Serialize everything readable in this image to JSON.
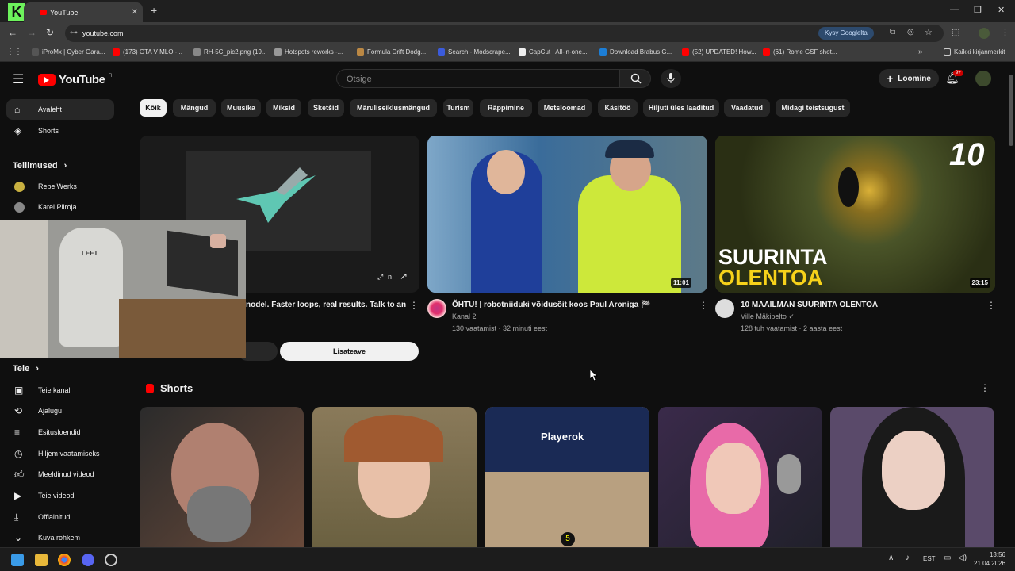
{
  "browser": {
    "tab_title": "YouTube",
    "url": "youtube.com",
    "gemini_label": "Kysy Googlelta",
    "bookmarks": [
      {
        "label": "iProMx | Cyber Gara...",
        "color": "#555"
      },
      {
        "label": "(173) GTA V MLO -...",
        "color": "#ff0000"
      },
      {
        "label": "RH-5C_pic2.png (19...",
        "color": "#888"
      },
      {
        "label": "Hotspots reworks -...",
        "color": "#999"
      },
      {
        "label": "Formula Drift Dodg...",
        "color": "#bb8844"
      },
      {
        "label": "Search - Modscrape...",
        "color": "#3b5bdb"
      },
      {
        "label": "CapCut | All-in-one...",
        "color": "#eee"
      },
      {
        "label": "Download Brabus G...",
        "color": "#1c7ed6"
      },
      {
        "label": "(52) UPDATED! How...",
        "color": "#ff0000"
      },
      {
        "label": "(61) Rome GSF shot...",
        "color": "#ff0000"
      }
    ],
    "all_bookmarks": "Kaikki kirjanmerkit"
  },
  "youtube": {
    "logo": "YouTube",
    "logo_region": "FI",
    "search_placeholder": "Otsige",
    "create_label": "Loomine",
    "notif_count": "9+",
    "chips": [
      "Kõik",
      "Mängud",
      "Muusika",
      "Miksid",
      "Sketšid",
      "Märuliseiklusmängud",
      "Turism",
      "Räppimine",
      "Metsloomad",
      "Käsitöö",
      "Hiljuti üles laaditud",
      "Vaadatud",
      "Midagi teistsugust"
    ],
    "sidebar": {
      "top": [
        {
          "label": "Avaleht",
          "icon": "home-icon"
        },
        {
          "label": "Shorts",
          "icon": "shorts-icon"
        }
      ],
      "subs_header": "Tellimused",
      "subs": [
        {
          "label": "RebelWerks"
        },
        {
          "label": "Karel Piiroja"
        }
      ],
      "you_header": "Teie",
      "you": [
        {
          "label": "Teie kanal",
          "icon": "channel-icon"
        },
        {
          "label": "Ajalugu",
          "icon": "history-icon"
        },
        {
          "label": "Esitusloendid",
          "icon": "playlists-icon"
        },
        {
          "label": "Hiljem vaatamiseks",
          "icon": "watch-later-icon"
        },
        {
          "label": "Meeldinud videod",
          "icon": "like-icon"
        },
        {
          "label": "Teie videod",
          "icon": "your-videos-icon"
        },
        {
          "label": "Offlainitud",
          "icon": "download-icon"
        },
        {
          "label": "Kuva rohkem",
          "icon": "chevron-down-icon"
        }
      ]
    },
    "ad": {
      "title_fragment": "nodel. Faster loops, real results. Talk to an",
      "cta": "Lisateave",
      "badge": "n"
    },
    "videos": [
      {
        "title": "ÕHTU! | robotniiduki võidusõit koos Paul Aroniga 🏁",
        "channel": "Kanal 2",
        "meta": "130 vaatamist · 32 minuti eest",
        "duration": "11:01"
      },
      {
        "title": "10 MAAILMAN SUURINTA OLENTOA",
        "channel": "Ville Mäkipelto",
        "meta": "128 tuh vaatamist · 2 aasta eest",
        "duration": "23:15",
        "thumb_text_top": "10",
        "thumb_text_1": "SUURINTA",
        "thumb_text_2": "OLENTOA"
      }
    ],
    "shorts_header": "Shorts",
    "shorts_overlay": "Playerok",
    "shorts_badge": "5",
    "webcam_text": "LEET"
  },
  "taskbar": {
    "lang": "EST",
    "time": "13:56",
    "date": "21.04.2026"
  }
}
